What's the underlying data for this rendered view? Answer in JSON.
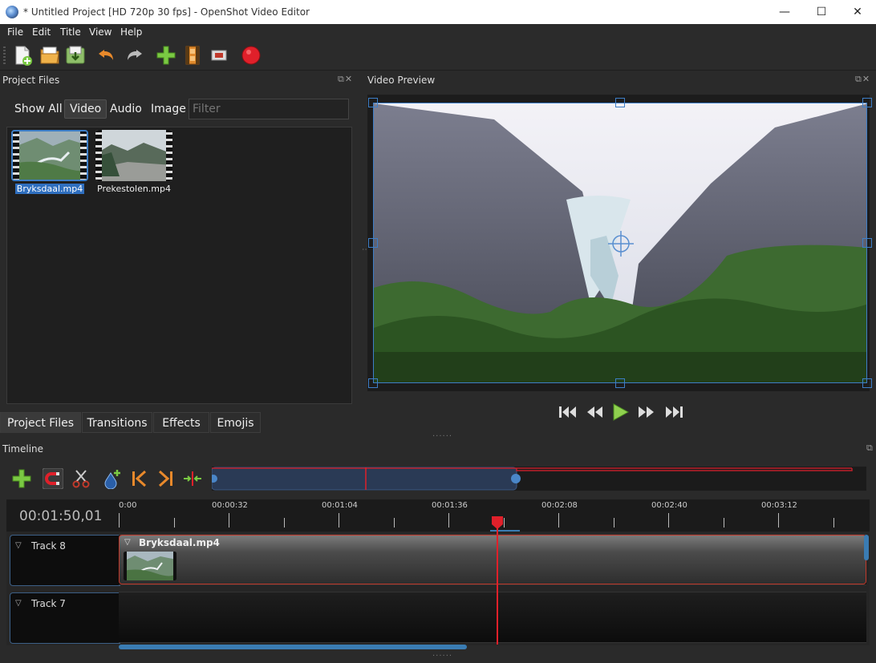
{
  "window": {
    "title": "* Untitled Project [HD 720p 30 fps] - OpenShot Video Editor",
    "minimize": "—",
    "maximize": "☐",
    "close": "✕"
  },
  "menu": [
    "File",
    "Edit",
    "Title",
    "View",
    "Help"
  ],
  "toolbar_icons": [
    "new-project-icon",
    "open-project-icon",
    "save-project-icon",
    "undo-icon",
    "redo-icon",
    "import-files-icon",
    "choose-profile-icon",
    "fullscreen-icon",
    "export-video-icon"
  ],
  "project_files": {
    "title": "Project Files",
    "filter_tabs": [
      "Show All",
      "Video",
      "Audio",
      "Image"
    ],
    "active_tab": "Video",
    "filter_placeholder": "Filter",
    "files": [
      {
        "name": "Bryksdaal.mp4",
        "selected": true
      },
      {
        "name": "Prekestolen.mp4",
        "selected": false
      }
    ]
  },
  "bottom_tabs": [
    "Project Files",
    "Transitions",
    "Effects",
    "Emojis"
  ],
  "video_preview": {
    "title": "Video Preview"
  },
  "timeline": {
    "title": "Timeline",
    "current_time": "00:01:50,01",
    "ticks": [
      "0:00",
      "00:00:32",
      "00:01:04",
      "00:01:36",
      "00:02:08",
      "00:02:40",
      "00:03:12"
    ],
    "tracks": [
      {
        "name": "Track 8",
        "clip": "Bryksdaal.mp4"
      },
      {
        "name": "Track 7",
        "clip": ""
      }
    ]
  },
  "colors": {
    "accent": "#3d7ec7",
    "playhead": "#e0202a",
    "selection": "#2f6fbf"
  }
}
